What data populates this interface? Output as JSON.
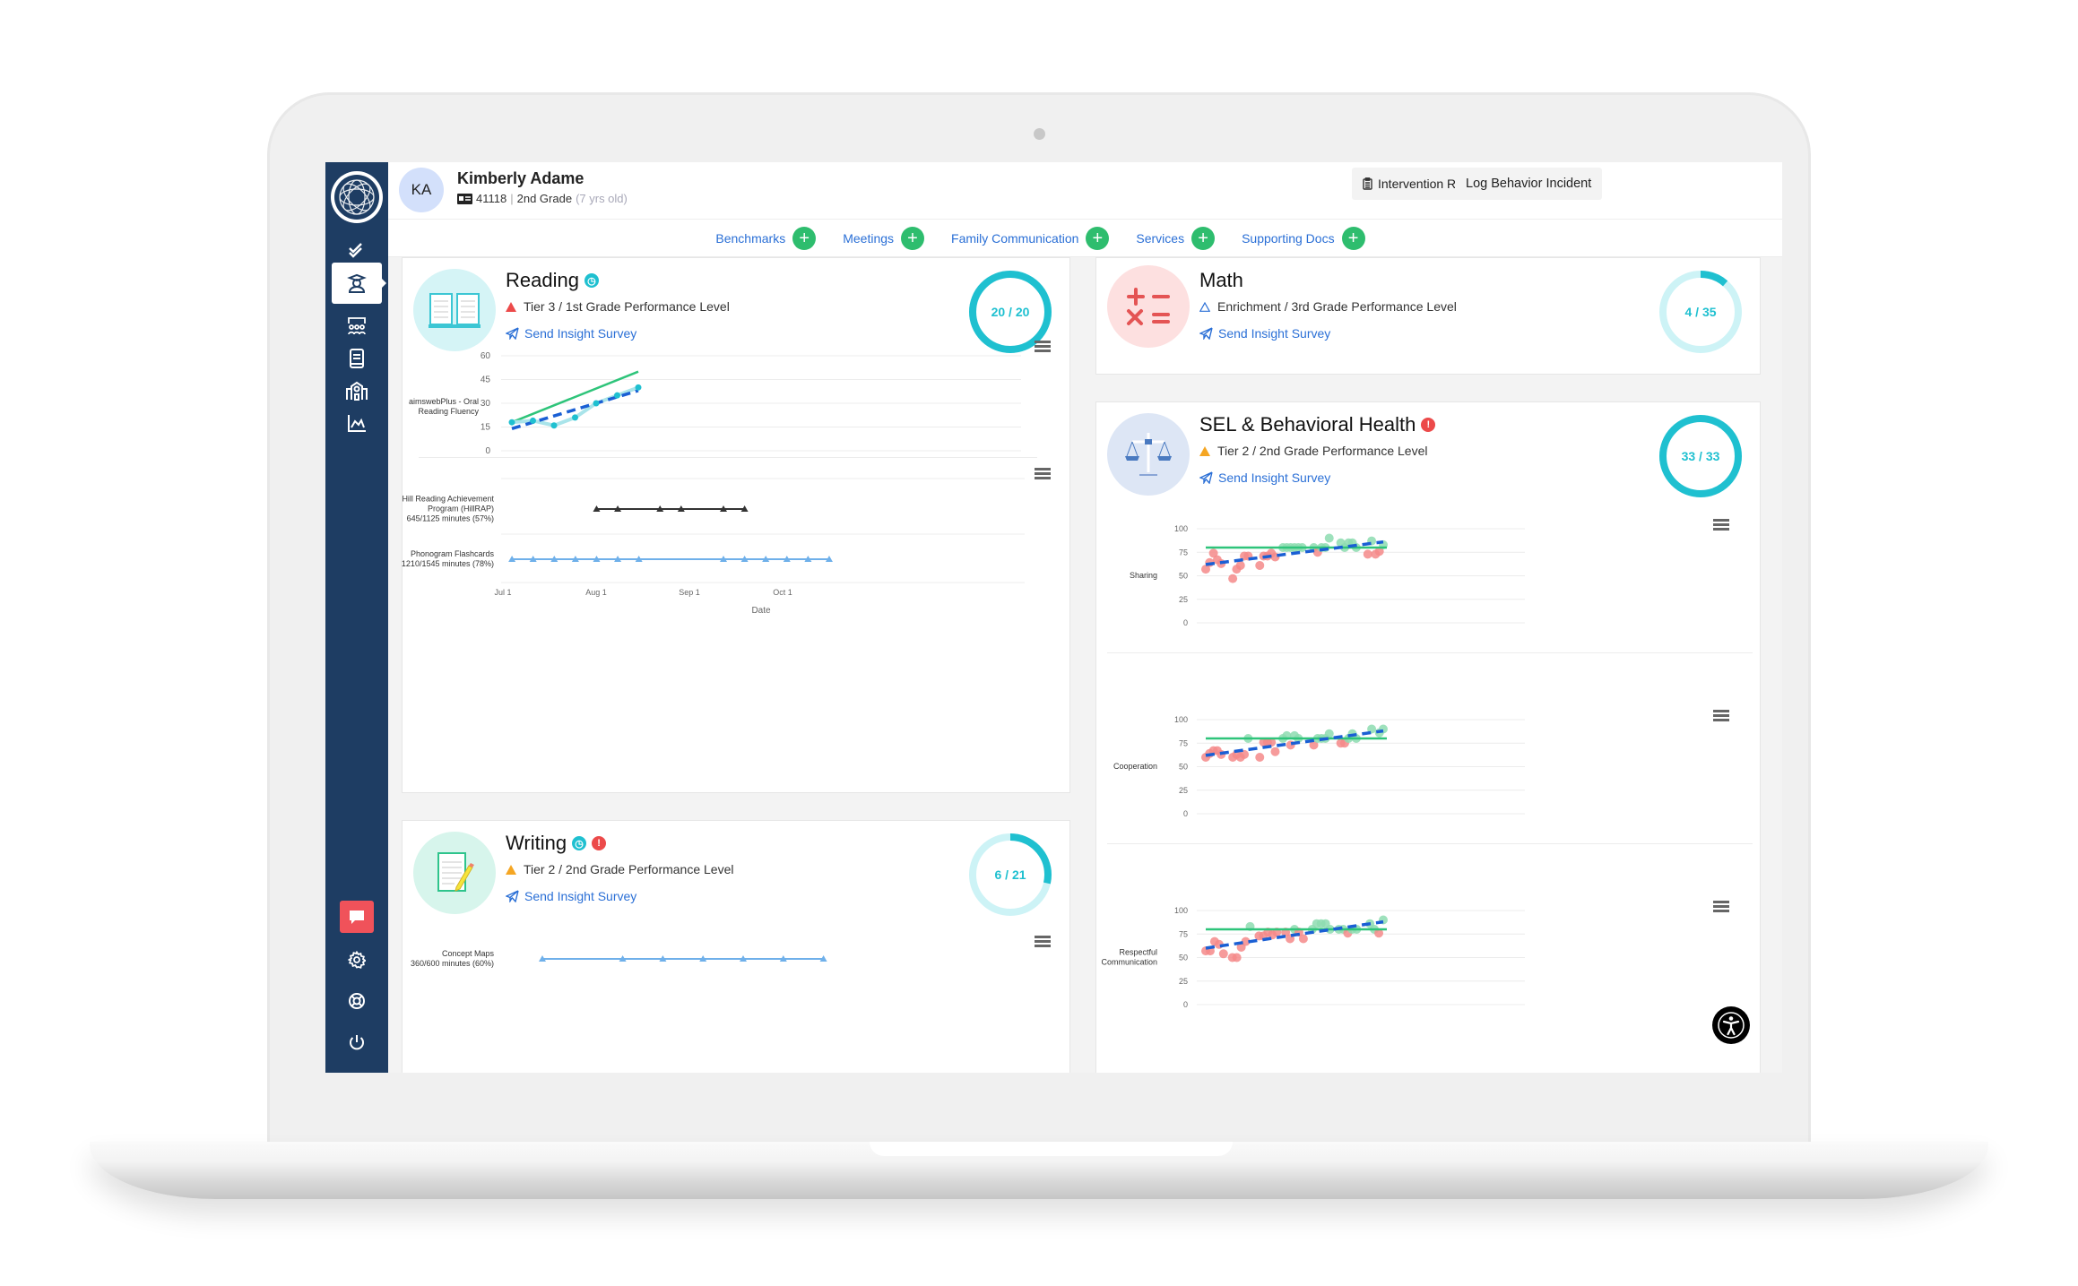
{
  "student": {
    "initials": "KA",
    "name": "Kimberly Adame",
    "id": "41118",
    "grade": "2nd Grade",
    "age": "(7 yrs old)"
  },
  "header_buttons": {
    "intervention_report": "Intervention Report",
    "log_behavior": "Log Behavior Incident"
  },
  "tabs": [
    {
      "label": "Benchmarks"
    },
    {
      "label": "Meetings"
    },
    {
      "label": "Family Communication"
    },
    {
      "label": "Services"
    },
    {
      "label": "Supporting Docs"
    }
  ],
  "sidebar": {
    "items": [
      {
        "icon": "checkmark-icon",
        "active": false
      },
      {
        "icon": "student-icon",
        "active": true
      },
      {
        "icon": "classroom-icon",
        "active": false
      },
      {
        "icon": "book-icon",
        "active": false
      },
      {
        "icon": "school-icon",
        "active": false
      },
      {
        "icon": "chart-icon",
        "active": false
      }
    ],
    "bottom": [
      "chat-icon",
      "gear-icon",
      "lifebuoy-icon",
      "power-icon"
    ]
  },
  "colors": {
    "sidebar": "#1e3d63",
    "accent_teal": "#1fc0d0",
    "link_blue": "#2a6fd6",
    "add_green": "#2ebd6e",
    "goal_green": "#2ec47a",
    "trend_blue": "#1a5fd4",
    "below_red": "#f58a8a",
    "above_green": "#8ddcb0"
  },
  "cards": {
    "reading": {
      "title": "Reading",
      "tier": "Tier 3 / 1st Grade Performance Level",
      "tier_color": "#ec4a4a",
      "survey": "Send Insight Survey",
      "progress_label": "20 / 20",
      "progress": 1.0
    },
    "math": {
      "title": "Math",
      "tier": "Enrichment / 3rd Grade Performance Level",
      "tier_color": "#2a6fd6",
      "survey": "Send Insight Survey",
      "progress_label": "4 / 35",
      "progress": 0.114
    },
    "sel": {
      "title": "SEL & Behavioral Health",
      "tier": "Tier 2 / 2nd Grade Performance Level",
      "tier_color": "#f5a623",
      "survey": "Send Insight Survey",
      "progress_label": "33 / 33",
      "progress": 1.0
    },
    "writing": {
      "title": "Writing",
      "tier": "Tier 2 / 2nd Grade Performance Level",
      "tier_color": "#f5a623",
      "survey": "Send Insight Survey",
      "progress_label": "6 / 21",
      "progress": 0.286
    }
  },
  "chart_data": [
    {
      "id": "reading-fluency",
      "type": "line",
      "ylabel": "aimswebPlus - Oral Reading Fluency",
      "ylim": [
        0,
        60
      ],
      "yticks": [
        0,
        15,
        30,
        45,
        60
      ],
      "x": [
        0,
        1,
        2,
        3,
        4,
        5,
        6
      ],
      "series": [
        {
          "name": "scores",
          "values": [
            18,
            19,
            16,
            21,
            30,
            35,
            40
          ]
        },
        {
          "name": "goal",
          "values": [
            18,
            50
          ],
          "x": [
            0,
            6
          ]
        },
        {
          "name": "trend",
          "values": [
            14,
            38
          ],
          "x": [
            0,
            6
          ]
        }
      ]
    },
    {
      "id": "reading-interventions",
      "type": "line",
      "xlabel": "Date",
      "xticks": [
        "Jul 1",
        "Aug 1",
        "Sep 1",
        "Oct 1"
      ],
      "series": [
        {
          "name": "Hill Reading Achievement Program (HillRAP)",
          "detail": "645/1125 minutes (57%)",
          "days": [
            31,
            38,
            52,
            59,
            73,
            80
          ]
        },
        {
          "name": "Phonogram Flashcards",
          "detail": "1210/1545 minutes (78%)",
          "days": [
            3,
            10,
            17,
            24,
            31,
            38,
            45,
            73,
            80,
            87,
            94,
            101,
            108
          ]
        }
      ]
    },
    {
      "id": "writing-interventions",
      "type": "line",
      "series": [
        {
          "name": "Concept Maps",
          "detail": "360/600 minutes (60%)",
          "days": [
            0,
            4,
            6,
            8,
            10,
            12,
            14
          ]
        }
      ]
    },
    {
      "id": "sel-sharing",
      "type": "scatter",
      "ylabel": "Sharing",
      "ylim": [
        0,
        100
      ],
      "yticks": [
        0,
        25,
        50,
        75,
        100
      ],
      "goal": 80,
      "trend": [
        62,
        86
      ],
      "points": [
        [
          0,
          57
        ],
        [
          1,
          64
        ],
        [
          2,
          74
        ],
        [
          3,
          67
        ],
        [
          4,
          63
        ],
        [
          7,
          47
        ],
        [
          8,
          57
        ],
        [
          9,
          61
        ],
        [
          10,
          71
        ],
        [
          11,
          71
        ],
        [
          14,
          61
        ],
        [
          15,
          71
        ],
        [
          16,
          71
        ],
        [
          17,
          74
        ],
        [
          18,
          70
        ],
        [
          20,
          80
        ],
        [
          21,
          80
        ],
        [
          22,
          80
        ],
        [
          23,
          80
        ],
        [
          24,
          80
        ],
        [
          25,
          80
        ],
        [
          28,
          80
        ],
        [
          29,
          75
        ],
        [
          30,
          80
        ],
        [
          31,
          80
        ],
        [
          32,
          90
        ],
        [
          35,
          85
        ],
        [
          36,
          80
        ],
        [
          37,
          85
        ],
        [
          38,
          85
        ],
        [
          39,
          80
        ],
        [
          42,
          73
        ],
        [
          43,
          87
        ],
        [
          44,
          73
        ],
        [
          45,
          76
        ],
        [
          46,
          83
        ]
      ]
    },
    {
      "id": "sel-cooperation",
      "type": "scatter",
      "ylabel": "Cooperation",
      "ylim": [
        0,
        100
      ],
      "yticks": [
        0,
        25,
        50,
        75,
        100
      ],
      "goal": 80,
      "trend": [
        62,
        88
      ],
      "points": [
        [
          0,
          60
        ],
        [
          1,
          64
        ],
        [
          2,
          67
        ],
        [
          3,
          67
        ],
        [
          4,
          63
        ],
        [
          7,
          60
        ],
        [
          8,
          63
        ],
        [
          9,
          60
        ],
        [
          10,
          63
        ],
        [
          11,
          80
        ],
        [
          14,
          60
        ],
        [
          15,
          76
        ],
        [
          16,
          76
        ],
        [
          17,
          76
        ],
        [
          18,
          66
        ],
        [
          20,
          80
        ],
        [
          21,
          83
        ],
        [
          22,
          73
        ],
        [
          23,
          83
        ],
        [
          24,
          80
        ],
        [
          28,
          73
        ],
        [
          29,
          80
        ],
        [
          30,
          80
        ],
        [
          31,
          80
        ],
        [
          32,
          85
        ],
        [
          35,
          75
        ],
        [
          36,
          75
        ],
        [
          37,
          80
        ],
        [
          38,
          85
        ],
        [
          39,
          80
        ],
        [
          43,
          90
        ],
        [
          45,
          86
        ],
        [
          46,
          90
        ]
      ]
    },
    {
      "id": "sel-respectful-communication",
      "type": "scatter",
      "ylabel": "Respectful Communication",
      "ylim": [
        0,
        100
      ],
      "yticks": [
        0,
        25,
        50,
        75,
        100
      ],
      "goal": 80,
      "trend": [
        60,
        88
      ],
      "points": [
        [
          0,
          57
        ],
        [
          1,
          57
        ],
        [
          2,
          67
        ],
        [
          3,
          64
        ],
        [
          4,
          54
        ],
        [
          6,
          50
        ],
        [
          7,
          50
        ],
        [
          8,
          61
        ],
        [
          9,
          67
        ],
        [
          10,
          83
        ],
        [
          12,
          73
        ],
        [
          13,
          73
        ],
        [
          14,
          77
        ],
        [
          15,
          74
        ],
        [
          16,
          77
        ],
        [
          18,
          77
        ],
        [
          19,
          70
        ],
        [
          20,
          80
        ],
        [
          21,
          77
        ],
        [
          22,
          70
        ],
        [
          24,
          80
        ],
        [
          25,
          86
        ],
        [
          26,
          86
        ],
        [
          27,
          86
        ],
        [
          28,
          80
        ],
        [
          30,
          80
        ],
        [
          31,
          80
        ],
        [
          32,
          76
        ],
        [
          33,
          80
        ],
        [
          34,
          80
        ],
        [
          37,
          86
        ],
        [
          38,
          80
        ],
        [
          39,
          76
        ],
        [
          40,
          90
        ]
      ]
    }
  ]
}
